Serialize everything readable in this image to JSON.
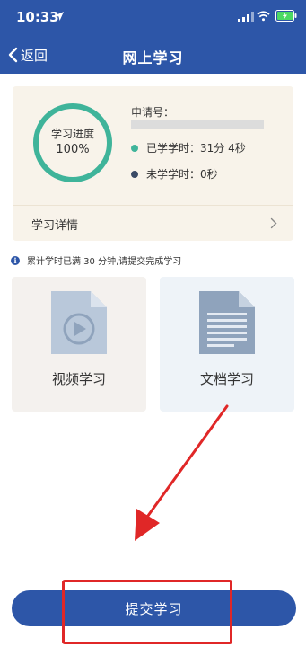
{
  "status_bar": {
    "time": "10:33"
  },
  "nav": {
    "back_label": "返回",
    "title": "网上学习"
  },
  "progress_card": {
    "ring_label": "学习进度",
    "progress_percent_label": "100%",
    "progress_fraction": 1.0,
    "application_label": "申请号：",
    "studied_label": "已学学时：31分 4秒",
    "unstudied_label": "未学学时：0秒",
    "detail_label": "学习详情"
  },
  "notice": {
    "text": "累计学时已满 30 分钟,请提交完成学习"
  },
  "modules": [
    {
      "label": "视频学习",
      "icon": "video-document-icon"
    },
    {
      "label": "文档学习",
      "icon": "text-document-icon"
    }
  ],
  "submit": {
    "label": "提交学习"
  },
  "colors": {
    "brand": "#2d56a8",
    "progress_green": "#3fb49a",
    "annotation_red": "#e02727"
  }
}
